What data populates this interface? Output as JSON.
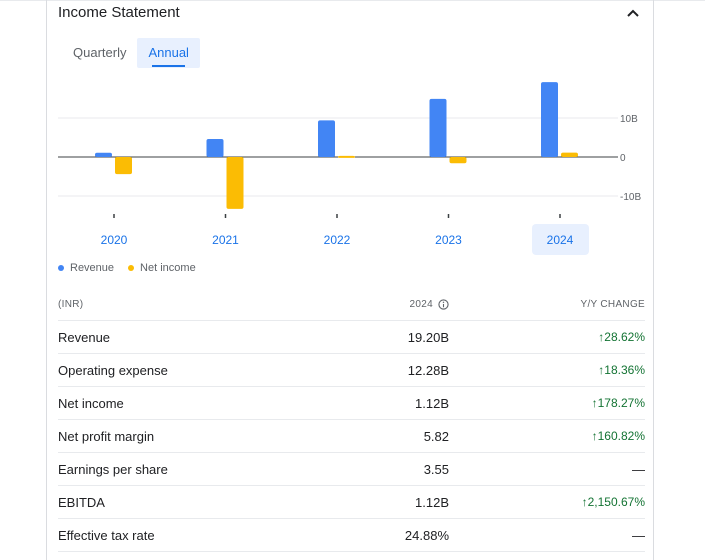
{
  "header": {
    "title": "Income Statement"
  },
  "tabs": [
    {
      "label": "Quarterly",
      "active": false
    },
    {
      "label": "Annual",
      "active": true
    }
  ],
  "chart_data": {
    "type": "bar",
    "categories": [
      "2020",
      "2021",
      "2022",
      "2023",
      "2024"
    ],
    "selected_category": "2024",
    "series": [
      {
        "name": "Revenue",
        "color": "#4285f4",
        "values": [
          1.1,
          4.6,
          9.4,
          14.9,
          19.2
        ]
      },
      {
        "name": "Net income",
        "color": "#fbbc04",
        "values": [
          -4.4,
          -13.3,
          0.3,
          -1.6,
          1.12
        ]
      }
    ],
    "y_ticks": [
      {
        "value": 10,
        "label": "10B"
      },
      {
        "value": 0,
        "label": "0"
      },
      {
        "value": -10,
        "label": "-10B"
      }
    ],
    "ylim": [
      -15,
      20
    ],
    "legend_position": "bottom-left",
    "grid": true
  },
  "table": {
    "col_label": "(INR)",
    "col_year": "2024",
    "col_change": "Y/Y CHANGE",
    "rows": [
      {
        "label": "Revenue",
        "value": "19.20B",
        "change": "28.62%",
        "arrow": "↑",
        "status": "up"
      },
      {
        "label": "Operating expense",
        "value": "12.28B",
        "change": "18.36%",
        "arrow": "↑",
        "status": "up"
      },
      {
        "label": "Net income",
        "value": "1.12B",
        "change": "178.27%",
        "arrow": "↑",
        "status": "up"
      },
      {
        "label": "Net profit margin",
        "value": "5.82",
        "change": "160.82%",
        "arrow": "↑",
        "status": "up"
      },
      {
        "label": "Earnings per share",
        "value": "3.55",
        "change": "—",
        "arrow": "",
        "status": "neutral"
      },
      {
        "label": "EBITDA",
        "value": "1.12B",
        "change": "2,150.67%",
        "arrow": "↑",
        "status": "up"
      },
      {
        "label": "Effective tax rate",
        "value": "24.88%",
        "change": "—",
        "arrow": "",
        "status": "neutral"
      }
    ]
  },
  "icons": {
    "collapse": "chevron-up-icon",
    "info": "info-icon"
  }
}
